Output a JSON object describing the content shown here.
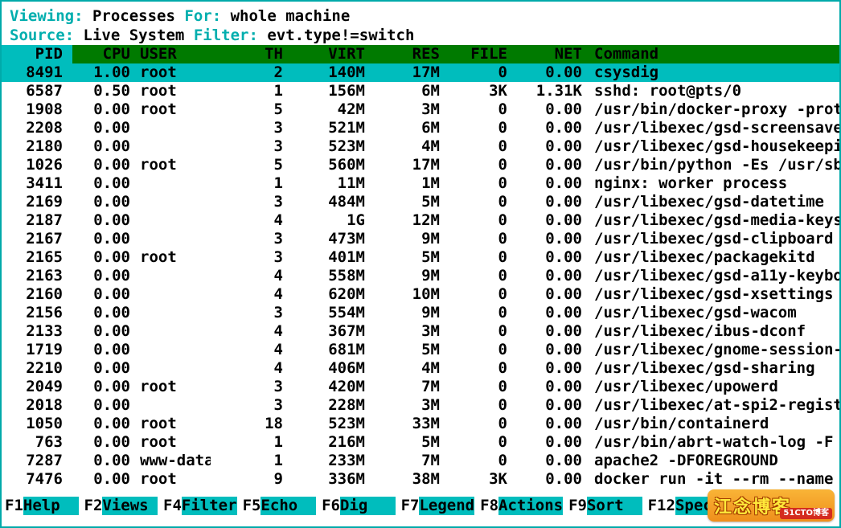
{
  "colors": {
    "accent_cyan": "#00aeae",
    "selection_cyan": "#00bdbd",
    "header_green": "#007a00",
    "border_teal": "#00aaaa",
    "watermark_orange": "#f29c27",
    "watermark_red": "#d42b1e"
  },
  "header": {
    "viewing_label": "Viewing:",
    "viewing_value": "Processes",
    "for_label": "For:",
    "for_value": "whole machine",
    "source_label": "Source:",
    "source_value": "Live System",
    "filter_label": "Filter:",
    "filter_value": "evt.type!=switch"
  },
  "table": {
    "columns": [
      "PID",
      "CPU",
      "USER",
      "TH",
      "VIRT",
      "RES",
      "FILE",
      "NET",
      "Command"
    ],
    "rows": [
      {
        "pid": "8491",
        "cpu": "1.00",
        "user": "root",
        "th": "2",
        "virt": "140M",
        "res": "17M",
        "file": "0",
        "net": "0.00",
        "command": "csysdig",
        "selected": true
      },
      {
        "pid": "6587",
        "cpu": "0.50",
        "user": "root",
        "th": "1",
        "virt": "156M",
        "res": "6M",
        "file": "3K",
        "net": "1.31K",
        "command": "sshd: root@pts/0"
      },
      {
        "pid": "1908",
        "cpu": "0.00",
        "user": "root",
        "th": "5",
        "virt": "42M",
        "res": "3M",
        "file": "0",
        "net": "0.00",
        "command": "/usr/bin/docker-proxy -prot"
      },
      {
        "pid": "2208",
        "cpu": "0.00",
        "user": "",
        "th": "3",
        "virt": "521M",
        "res": "6M",
        "file": "0",
        "net": "0.00",
        "command": "/usr/libexec/gsd-screensave"
      },
      {
        "pid": "2180",
        "cpu": "0.00",
        "user": "",
        "th": "3",
        "virt": "523M",
        "res": "4M",
        "file": "0",
        "net": "0.00",
        "command": "/usr/libexec/gsd-housekeepi"
      },
      {
        "pid": "1026",
        "cpu": "0.00",
        "user": "root",
        "th": "5",
        "virt": "560M",
        "res": "17M",
        "file": "0",
        "net": "0.00",
        "command": "/usr/bin/python -Es /usr/sb"
      },
      {
        "pid": "3411",
        "cpu": "0.00",
        "user": "",
        "th": "1",
        "virt": "11M",
        "res": "1M",
        "file": "0",
        "net": "0.00",
        "command": "nginx: worker process"
      },
      {
        "pid": "2169",
        "cpu": "0.00",
        "user": "",
        "th": "3",
        "virt": "484M",
        "res": "5M",
        "file": "0",
        "net": "0.00",
        "command": "/usr/libexec/gsd-datetime"
      },
      {
        "pid": "2187",
        "cpu": "0.00",
        "user": "",
        "th": "4",
        "virt": "1G",
        "res": "12M",
        "file": "0",
        "net": "0.00",
        "command": "/usr/libexec/gsd-media-keys"
      },
      {
        "pid": "2167",
        "cpu": "0.00",
        "user": "",
        "th": "3",
        "virt": "473M",
        "res": "9M",
        "file": "0",
        "net": "0.00",
        "command": "/usr/libexec/gsd-clipboard"
      },
      {
        "pid": "2165",
        "cpu": "0.00",
        "user": "root",
        "th": "3",
        "virt": "401M",
        "res": "5M",
        "file": "0",
        "net": "0.00",
        "command": "/usr/libexec/packagekitd"
      },
      {
        "pid": "2163",
        "cpu": "0.00",
        "user": "",
        "th": "4",
        "virt": "558M",
        "res": "9M",
        "file": "0",
        "net": "0.00",
        "command": "/usr/libexec/gsd-a11y-keybo"
      },
      {
        "pid": "2160",
        "cpu": "0.00",
        "user": "",
        "th": "4",
        "virt": "620M",
        "res": "10M",
        "file": "0",
        "net": "0.00",
        "command": "/usr/libexec/gsd-xsettings"
      },
      {
        "pid": "2156",
        "cpu": "0.00",
        "user": "",
        "th": "3",
        "virt": "554M",
        "res": "9M",
        "file": "0",
        "net": "0.00",
        "command": "/usr/libexec/gsd-wacom"
      },
      {
        "pid": "2133",
        "cpu": "0.00",
        "user": "",
        "th": "4",
        "virt": "367M",
        "res": "3M",
        "file": "0",
        "net": "0.00",
        "command": "/usr/libexec/ibus-dconf"
      },
      {
        "pid": "1719",
        "cpu": "0.00",
        "user": "",
        "th": "4",
        "virt": "681M",
        "res": "5M",
        "file": "0",
        "net": "0.00",
        "command": "/usr/libexec/gnome-session-"
      },
      {
        "pid": "2210",
        "cpu": "0.00",
        "user": "",
        "th": "4",
        "virt": "406M",
        "res": "4M",
        "file": "0",
        "net": "0.00",
        "command": "/usr/libexec/gsd-sharing"
      },
      {
        "pid": "2049",
        "cpu": "0.00",
        "user": "root",
        "th": "3",
        "virt": "420M",
        "res": "7M",
        "file": "0",
        "net": "0.00",
        "command": "/usr/libexec/upowerd"
      },
      {
        "pid": "2018",
        "cpu": "0.00",
        "user": "",
        "th": "3",
        "virt": "228M",
        "res": "3M",
        "file": "0",
        "net": "0.00",
        "command": "/usr/libexec/at-spi2-regist"
      },
      {
        "pid": "1050",
        "cpu": "0.00",
        "user": "root",
        "th": "18",
        "virt": "523M",
        "res": "33M",
        "file": "0",
        "net": "0.00",
        "command": "/usr/bin/containerd"
      },
      {
        "pid": "763",
        "cpu": "0.00",
        "user": "root",
        "th": "1",
        "virt": "216M",
        "res": "5M",
        "file": "0",
        "net": "0.00",
        "command": "/usr/bin/abrt-watch-log -F"
      },
      {
        "pid": "7287",
        "cpu": "0.00",
        "user": "www-data",
        "th": "1",
        "virt": "233M",
        "res": "7M",
        "file": "0",
        "net": "0.00",
        "command": "apache2 -DFOREGROUND"
      },
      {
        "pid": "7476",
        "cpu": "0.00",
        "user": "root",
        "th": "9",
        "virt": "336M",
        "res": "38M",
        "file": "3K",
        "net": "0.00",
        "command": "docker run -it --rm --name"
      }
    ]
  },
  "fkeys": [
    {
      "key": "F1",
      "label": "Help"
    },
    {
      "key": "F2",
      "label": "Views"
    },
    {
      "key": "F4",
      "label": "Filter"
    },
    {
      "key": "F5",
      "label": "Echo"
    },
    {
      "key": "F6",
      "label": "Dig"
    },
    {
      "key": "F7",
      "label": "Legend"
    },
    {
      "key": "F8",
      "label": "Actions"
    },
    {
      "key": "F9",
      "label": "Sort"
    },
    {
      "key": "F12",
      "label": "Spectro"
    }
  ],
  "watermark": {
    "text_main": "江念博客",
    "badge": "51CTO博客"
  }
}
